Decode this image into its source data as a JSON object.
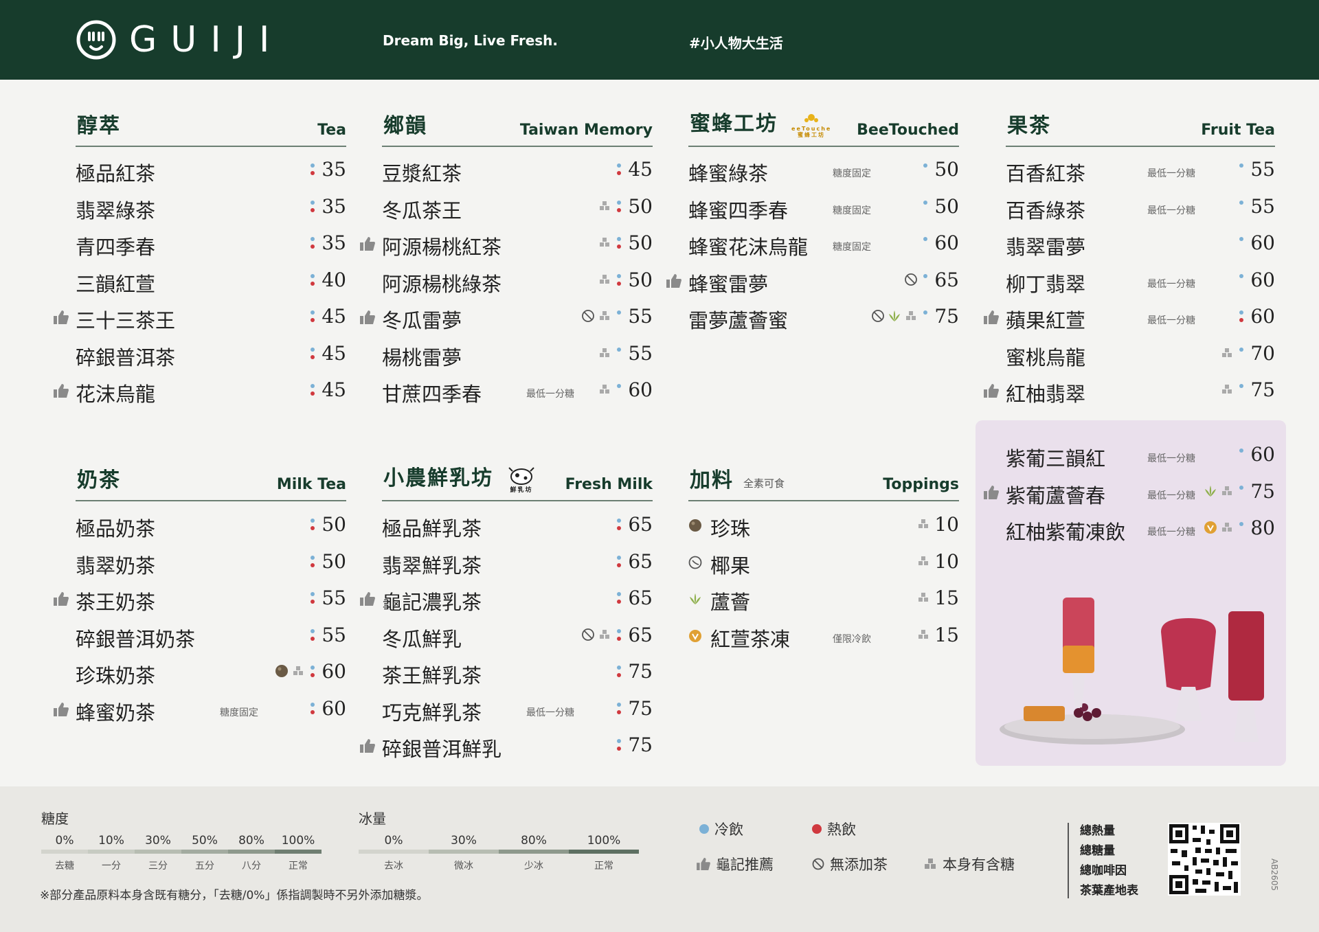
{
  "header": {
    "brand": "GUIJI",
    "slogan": "Dream Big, Live Fresh.",
    "hashtag": "#小人物大生活"
  },
  "colors": {
    "brand_green": "#173c2c",
    "cold_dot": "#7cb1d6",
    "hot_dot": "#d0393f",
    "highlight_box": "#eae0ec"
  },
  "sections": {
    "tea": {
      "title": "醇萃",
      "en": "Tea",
      "items": [
        {
          "name": "極品紅茶",
          "price": "35",
          "rec": false,
          "note": ""
        },
        {
          "name": "翡翠綠茶",
          "price": "35",
          "rec": false,
          "note": ""
        },
        {
          "name": "青四季春",
          "price": "35",
          "rec": false,
          "note": ""
        },
        {
          "name": "三韻紅萱",
          "price": "40",
          "rec": false,
          "note": ""
        },
        {
          "name": "三十三茶王",
          "price": "45",
          "rec": true,
          "note": ""
        },
        {
          "name": "碎銀普洱茶",
          "price": "45",
          "rec": false,
          "note": ""
        },
        {
          "name": "花沫烏龍",
          "price": "45",
          "rec": true,
          "note": ""
        }
      ]
    },
    "taiwan": {
      "title": "鄉韻",
      "en": "Taiwan Memory",
      "items": [
        {
          "name": "豆漿紅茶",
          "price": "45",
          "rec": false,
          "note": ""
        },
        {
          "name": "冬瓜茶王",
          "price": "50",
          "rec": false,
          "note": ""
        },
        {
          "name": "阿源楊桃紅茶",
          "price": "50",
          "rec": true,
          "note": ""
        },
        {
          "name": "阿源楊桃綠茶",
          "price": "50",
          "rec": false,
          "note": ""
        },
        {
          "name": "冬瓜雷夢",
          "price": "55",
          "rec": true,
          "note": ""
        },
        {
          "name": "楊桃雷夢",
          "price": "55",
          "rec": false,
          "note": ""
        },
        {
          "name": "甘蔗四季春",
          "price": "60",
          "rec": false,
          "note": "最低一分糖"
        }
      ]
    },
    "bee": {
      "title": "蜜蜂工坊",
      "en": "BeeTouched",
      "badge": "BeeTouched 蜜蜂工坊",
      "items": [
        {
          "name": "蜂蜜綠茶",
          "price": "50",
          "rec": false,
          "note": "糖度固定"
        },
        {
          "name": "蜂蜜四季春",
          "price": "50",
          "rec": false,
          "note": "糖度固定"
        },
        {
          "name": "蜂蜜花沫烏龍",
          "price": "60",
          "rec": false,
          "note": "糖度固定"
        },
        {
          "name": "蜂蜜雷夢",
          "price": "65",
          "rec": true,
          "note": ""
        },
        {
          "name": "雷夢蘆薈蜜",
          "price": "75",
          "rec": false,
          "note": ""
        }
      ]
    },
    "fruit": {
      "title": "果茶",
      "en": "Fruit Tea",
      "items": [
        {
          "name": "百香紅茶",
          "price": "55",
          "rec": false,
          "note": "最低一分糖"
        },
        {
          "name": "百香綠茶",
          "price": "55",
          "rec": false,
          "note": "最低一分糖"
        },
        {
          "name": "翡翠雷夢",
          "price": "60",
          "rec": false,
          "note": ""
        },
        {
          "name": "柳丁翡翠",
          "price": "60",
          "rec": false,
          "note": "最低一分糖"
        },
        {
          "name": "蘋果紅萱",
          "price": "60",
          "rec": true,
          "note": "最低一分糖"
        },
        {
          "name": "蜜桃烏龍",
          "price": "70",
          "rec": false,
          "note": ""
        },
        {
          "name": "紅柚翡翠",
          "price": "75",
          "rec": true,
          "note": ""
        }
      ],
      "special": [
        {
          "name": "紫葡三韻紅",
          "price": "60",
          "rec": false,
          "note": "最低一分糖"
        },
        {
          "name": "紫葡蘆薈春",
          "price": "75",
          "rec": true,
          "note": "最低一分糖"
        },
        {
          "name": "紅柚紫葡凍飲",
          "price": "80",
          "rec": false,
          "note": "最低一分糖"
        }
      ]
    },
    "milktea": {
      "title": "奶茶",
      "en": "Milk Tea",
      "items": [
        {
          "name": "極品奶茶",
          "price": "50",
          "rec": false,
          "note": ""
        },
        {
          "name": "翡翠奶茶",
          "price": "50",
          "rec": false,
          "note": ""
        },
        {
          "name": "茶王奶茶",
          "price": "55",
          "rec": true,
          "note": ""
        },
        {
          "name": "碎銀普洱奶茶",
          "price": "55",
          "rec": false,
          "note": ""
        },
        {
          "name": "珍珠奶茶",
          "price": "60",
          "rec": false,
          "note": ""
        },
        {
          "name": "蜂蜜奶茶",
          "price": "60",
          "rec": true,
          "note": "糖度固定"
        }
      ]
    },
    "freshmilk": {
      "title": "小農鮮乳坊",
      "en": "Fresh Milk",
      "badge": "鮮乳坊",
      "items": [
        {
          "name": "極品鮮乳茶",
          "price": "65",
          "rec": false,
          "note": ""
        },
        {
          "name": "翡翠鮮乳茶",
          "price": "65",
          "rec": false,
          "note": ""
        },
        {
          "name": "龜記濃乳茶",
          "price": "65",
          "rec": true,
          "note": ""
        },
        {
          "name": "冬瓜鮮乳",
          "price": "65",
          "rec": false,
          "note": ""
        },
        {
          "name": "茶王鮮乳茶",
          "price": "75",
          "rec": false,
          "note": ""
        },
        {
          "name": "巧克鮮乳茶",
          "price": "75",
          "rec": false,
          "note": "最低一分糖"
        },
        {
          "name": "碎銀普洱鮮乳",
          "price": "75",
          "rec": true,
          "note": ""
        }
      ]
    },
    "toppings": {
      "title": "加料",
      "note": "全素可食",
      "en": "Toppings",
      "items": [
        {
          "name": "珍珠",
          "price": "10",
          "note": ""
        },
        {
          "name": "椰果",
          "price": "10",
          "note": ""
        },
        {
          "name": "蘆薈",
          "price": "15",
          "note": ""
        },
        {
          "name": "紅萱茶凍",
          "price": "15",
          "note": "僅限冷飲"
        }
      ]
    }
  },
  "footer": {
    "sugar": {
      "label": "糖度",
      "levels": [
        {
          "pct": "0%",
          "name": "去糖"
        },
        {
          "pct": "10%",
          "name": "一分"
        },
        {
          "pct": "30%",
          "name": "三分"
        },
        {
          "pct": "50%",
          "name": "五分"
        },
        {
          "pct": "80%",
          "name": "八分"
        },
        {
          "pct": "100%",
          "name": "正常"
        }
      ]
    },
    "ice": {
      "label": "冰量",
      "levels": [
        {
          "pct": "0%",
          "name": "去冰"
        },
        {
          "pct": "30%",
          "name": "微冰"
        },
        {
          "pct": "80%",
          "name": "少冰"
        },
        {
          "pct": "100%",
          "name": "正常"
        }
      ]
    },
    "note": "※部分產品原料本身含既有糖分，「去糖/0%」係指調製時不另外添加糖漿。",
    "legend": {
      "cold": "冷飲",
      "hot": "熱飲",
      "recommend": "龜記推薦",
      "no_tea": "無添加茶",
      "has_sugar": "本身有含糖"
    },
    "info": [
      "總熱量",
      "總糖量",
      "總咖啡因",
      "茶葉產地表"
    ],
    "code": "AB2605"
  }
}
